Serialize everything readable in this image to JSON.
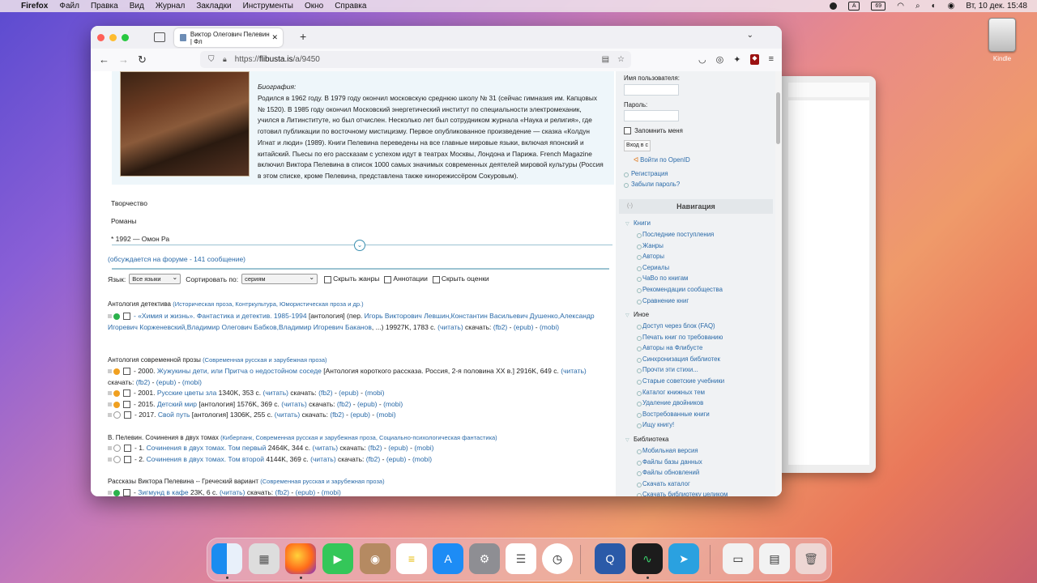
{
  "menubar": {
    "apple": "",
    "items": [
      "Firefox",
      "Файл",
      "Правка",
      "Вид",
      "Журнал",
      "Закладки",
      "Инструменты",
      "Окно",
      "Справка"
    ],
    "kbd": "A",
    "battery": "69",
    "datetime": "Вт, 10 дек.  15:48"
  },
  "desktop": {
    "kindle_label": "Kindle"
  },
  "browser": {
    "tab_title": "Виктор Олегович Пелевин | Фл",
    "url_prefix": "https://",
    "url_host": "flibusta.is",
    "url_path": "/a/9450"
  },
  "bio": {
    "title": "Биография:",
    "text": "Родился в 1962 году. В 1979 году окончил московскую среднюю школу № 31 (сейчас гимназия им. Капцовых № 1520). В 1985 году окончил Московский энергетический институт по специальности электромеханик, учился в Литинституте, но был отчислен. Несколько лет был сотрудником журнала «Наука и религия», где готовил публикации по восточному мистицизму. Первое опубликованное произведение — сказка «Колдун Игнат и люди» (1989). Книги Пелевина переведены на все главные мировые языки, включая японский и китайский. Пьесы по его рассказам с успехом идут в театрах Москвы, Лондона и Парижа. French Magazine включил Виктора Пелевина в список 1000 самых значимых современных деятелей мировой культуры (Россия в этом списке, кроме Пелевина, представлена также кинорежиссёром Сокуровым)."
  },
  "sections": {
    "creativity": "Творчество",
    "novels": "Романы",
    "first_item": "* 1992 — Омон Ра"
  },
  "forum": "(обсуждается на форуме - 141 сообщение)",
  "filters": {
    "lang_label": "Язык:",
    "lang_value": "Все языки",
    "sort_label": "Сортировать по:",
    "sort_value": "сериям",
    "hide_genres": "Скрыть жанры",
    "annotations": "Аннотации",
    "hide_ratings": "Скрыть оценки"
  },
  "series": [
    {
      "name": "Антология детектива",
      "genres": "(Историческая проза, Контркультура, Юмористическая проза и др.)",
      "line1": "- «Химия и жизнь». Фантастика и детектив. 1985-1994",
      "line1b": " [антология] (пер. ",
      "people": "Игорь Викторович Левшин,Константин Васильевич Душенко,Александр Игоревич Корженевский,Владимир Олегович Бабков,Владимир Игоревич Баканов",
      "tail": ", ...) 19927K, 1783 с.",
      "read": "(читать)",
      "dl": "скачать:",
      "fb2": "(fb2)",
      "epub": "(epub)",
      "mobi": "(mobi)"
    },
    {
      "name": "Антология современной прозы",
      "genres": "(Современная русская и зарубежная проза)",
      "items": [
        {
          "num": "- 2000.",
          "title": "Жужукины дети, или Притча о недостойном соседе",
          "info": " [Антология короткого рассказа. Россия, 2-я половина XX в.] 2916K, 649 с."
        },
        {
          "num": "- 2001.",
          "title": "Русские цветы зла",
          "info": " 1340K, 353 с."
        },
        {
          "num": "- 2015.",
          "title": "Детский мир",
          "info": " [антология] 1576K, 369 с."
        },
        {
          "num": "- 2017.",
          "title": "Свой путь",
          "info": " [антология] 1306K, 255 с."
        }
      ]
    },
    {
      "name": "В. Пелевин. Сочинения в двух томах",
      "genres": "(Киберпанк, Современная русская и зарубежная проза, Социально-психологическая фантастика)",
      "items": [
        {
          "num": "- 1.",
          "title": "Сочинения в двух томах. Том первый",
          "info": " 2464K, 344 с."
        },
        {
          "num": "- 2.",
          "title": "Сочинения в двух томах. Том второй",
          "info": " 4144K, 369 с."
        }
      ]
    },
    {
      "name": "Рассказы Виктора Пелевина -- Греческий вариант",
      "genres": "(Современная русская и зарубежная проза)",
      "items": [
        {
          "num": "-",
          "title": "Зигмунд в кафе",
          "info": " 23K, 6 с."
        }
      ]
    }
  ],
  "sidebar": {
    "username_label": "Имя пользователя:",
    "password_label": "Пароль:",
    "remember": "Запомнить меня",
    "login_btn": "Вход в с",
    "openid": "Войти по OpenID",
    "register": "Регистрация",
    "forgot": "Забыли пароль?",
    "nav_toggle": "(-)",
    "nav_title": "Навигация",
    "cat_books": "Книги",
    "books": [
      "Последние поступления",
      "Жанры",
      "Авторы",
      "Сериалы",
      "ЧаВо по книгам",
      "Рекомендации сообщества",
      "Сравнение книг"
    ],
    "cat_other": "Иное",
    "other": [
      "Доступ через блок (FAQ)",
      "Печать книг по требованию",
      "Авторы на Флибусте",
      "Синхронизация библиотек",
      "Прочти эти стихи...",
      "Старые советские учебники",
      "Каталог книжных тем",
      "Удаление двойников",
      "Востребованные книги",
      "Ищу книгу!"
    ],
    "cat_library": "Библиотека",
    "library": [
      "Мобильная версия",
      "Файлы базы данных",
      "Файлы обновлений",
      "Скачать каталог",
      "Скачать библиотеку целиком"
    ]
  },
  "colors": {
    "link": "#2a6aa8",
    "accent": "#9cc3d2",
    "firefox_red": "#e8473b"
  }
}
